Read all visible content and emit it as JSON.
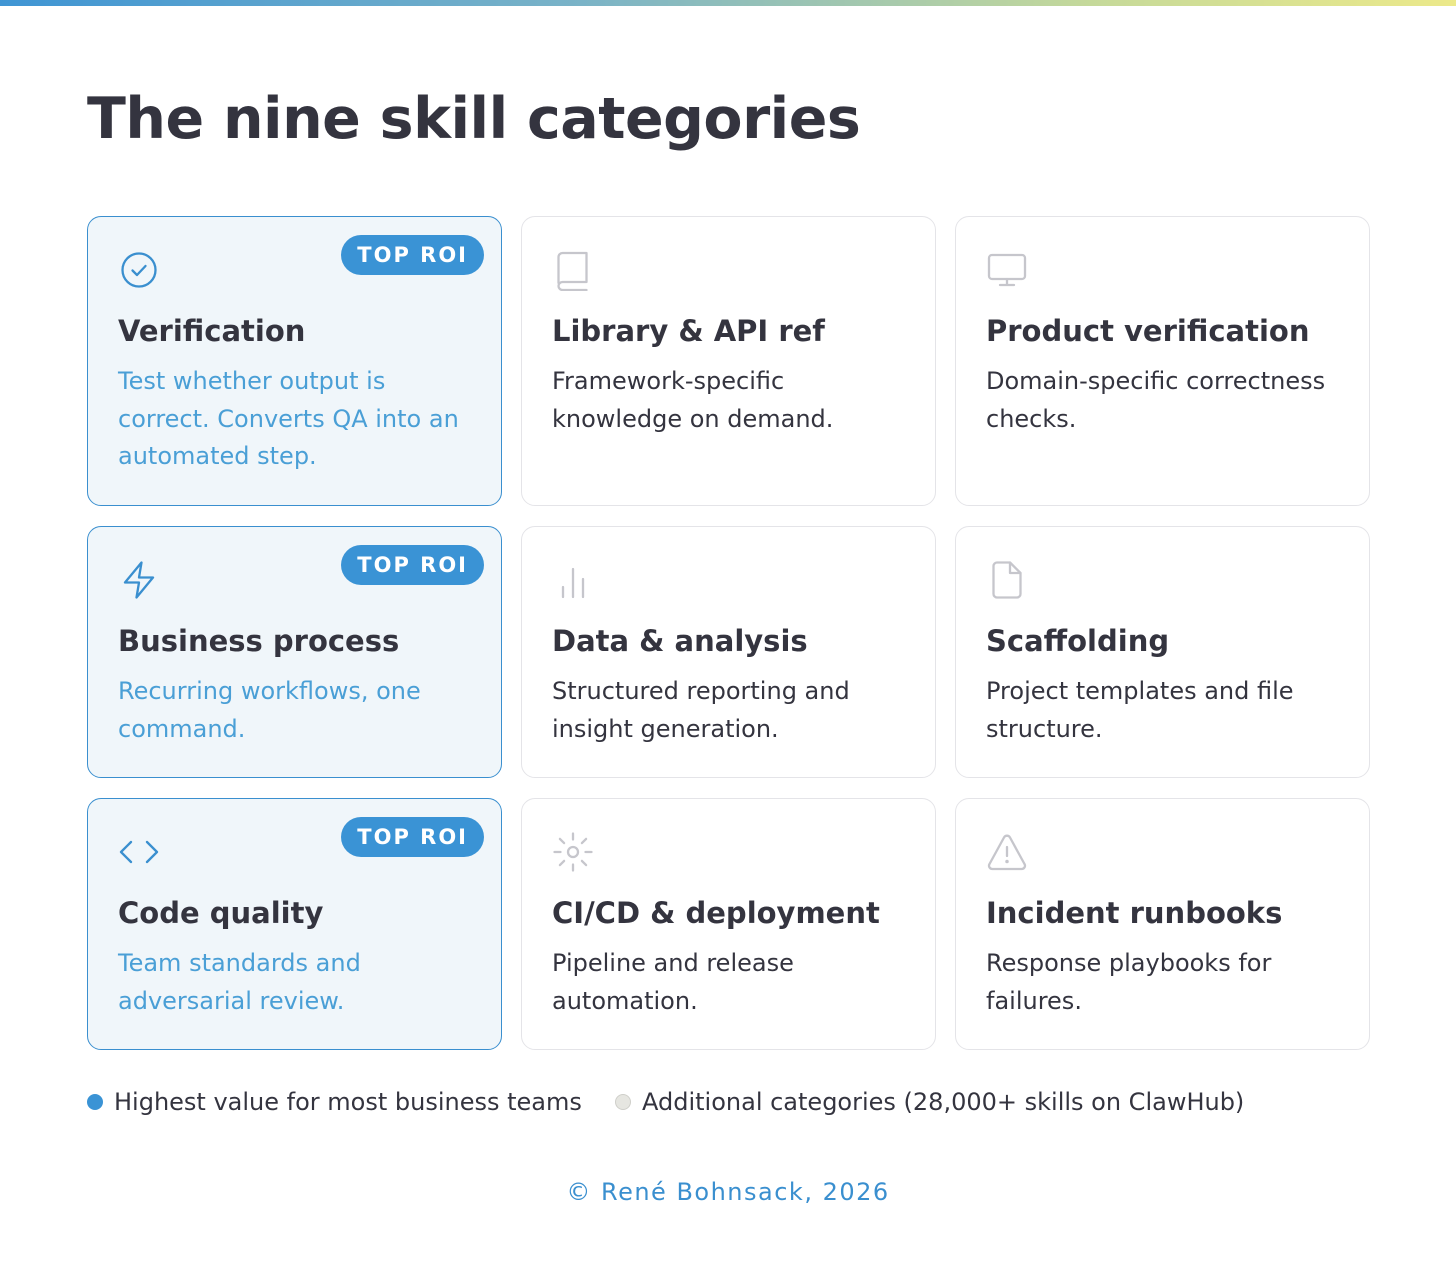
{
  "title": "The nine skill categories",
  "badge_label": "TOP ROI",
  "colors": {
    "accent": "#3a93d5",
    "highlight_bg": "#f0f6fa",
    "highlight_border": "#3a8fcf",
    "muted_icon": "#c6c6cc",
    "text": "#34343f"
  },
  "cards": [
    {
      "name": "Verification",
      "description": "Test whether output is correct. Converts QA into an automated step.",
      "icon": "check-circle-icon",
      "top_roi": true
    },
    {
      "name": "Library & API ref",
      "description": "Framework-specific knowledge on demand.",
      "icon": "book-icon",
      "top_roi": false
    },
    {
      "name": "Product verification",
      "description": "Domain-specific correctness checks.",
      "icon": "monitor-icon",
      "top_roi": false
    },
    {
      "name": "Business process",
      "description": "Recurring workflows, one command.",
      "icon": "lightning-icon",
      "top_roi": true
    },
    {
      "name": "Data & analysis",
      "description": "Structured reporting and insight generation.",
      "icon": "bar-chart-icon",
      "top_roi": false
    },
    {
      "name": "Scaffolding",
      "description": "Project templates and file structure.",
      "icon": "file-icon",
      "top_roi": false
    },
    {
      "name": "Code quality",
      "description": "Team standards and adversarial review.",
      "icon": "code-brackets-icon",
      "top_roi": true
    },
    {
      "name": "CI/CD & deployment",
      "description": "Pipeline and release automation.",
      "icon": "sun-gear-icon",
      "top_roi": false
    },
    {
      "name": "Incident runbooks",
      "description": "Response playbooks for failures.",
      "icon": "warning-triangle-icon",
      "top_roi": false
    }
  ],
  "legend": {
    "highlight": {
      "label": "Highest value for most business teams",
      "color": "#3a93d5"
    },
    "other": {
      "label": "Additional categories (28,000+ skills on ClawHub)",
      "color": "#e6e6e1"
    }
  },
  "footer": "© René Bohnsack, 2026"
}
